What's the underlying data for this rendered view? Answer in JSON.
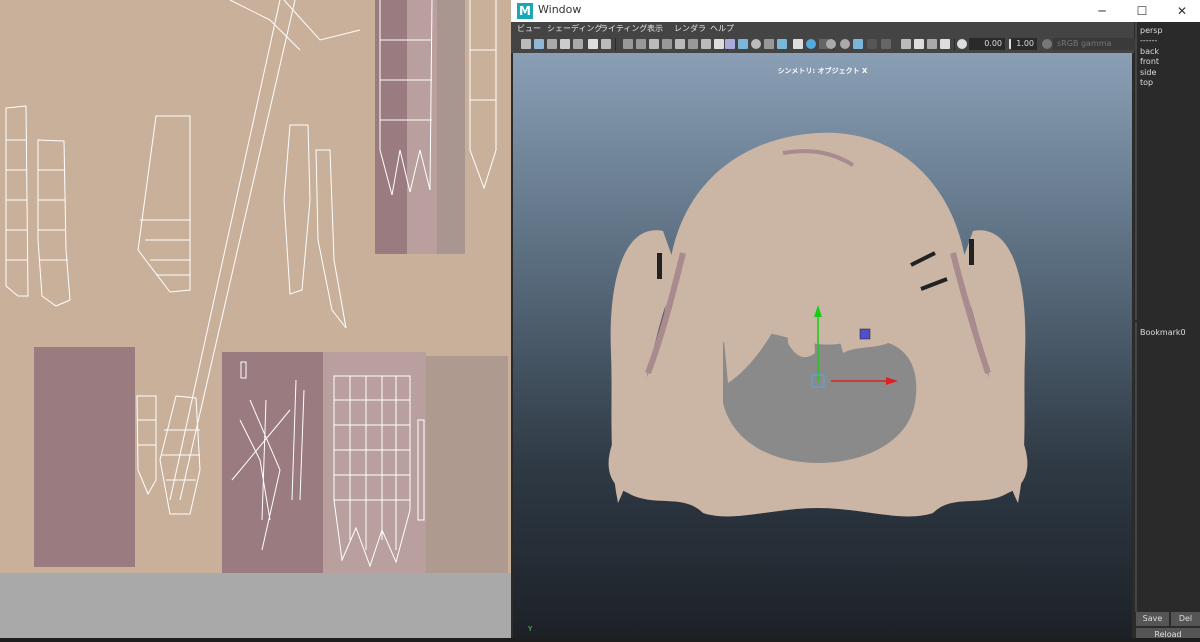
{
  "window": {
    "title": "Window",
    "logo_letter": "M",
    "minimize": "─",
    "maximize": "☐",
    "close": "✕"
  },
  "menus": [
    "ビュー",
    "シェーディング",
    "ライティング",
    "表示",
    "レンダラ",
    "ヘルプ"
  ],
  "toolbar": {
    "exposure": "0.00",
    "gamma_value": "1.00",
    "color_space": "sRGB gamma"
  },
  "viewport": {
    "label": "シンメトリ: オブジェクト X",
    "axis_label": "Y",
    "background_top": "#8a9fb5",
    "background_bottom": "#1c2127",
    "hair_color": "#cbb5a4",
    "hair_shadow": "#a98a8e",
    "face_color": "#8a8a8a"
  },
  "cameras": [
    "persp",
    "------",
    "back",
    "front",
    "side",
    "top"
  ],
  "bookmarks": {
    "items": [
      "Bookmark0"
    ],
    "save_label": "Save",
    "delete_label": "Del",
    "reload_label": "Reload"
  },
  "uv_editor": {
    "background": "#c9b09b",
    "uv_shell_dark": "#9a7b80",
    "uv_shell_light": "#b99f9e",
    "wire_color": "#ffffff"
  },
  "icons": [
    "camera-icon",
    "grid-icon",
    "wireframe-icon",
    "shaded-icon",
    "texture-icon",
    "light-icon",
    "isolate-icon",
    "xray-icon",
    "exposure-icon",
    "gamma-icon"
  ]
}
